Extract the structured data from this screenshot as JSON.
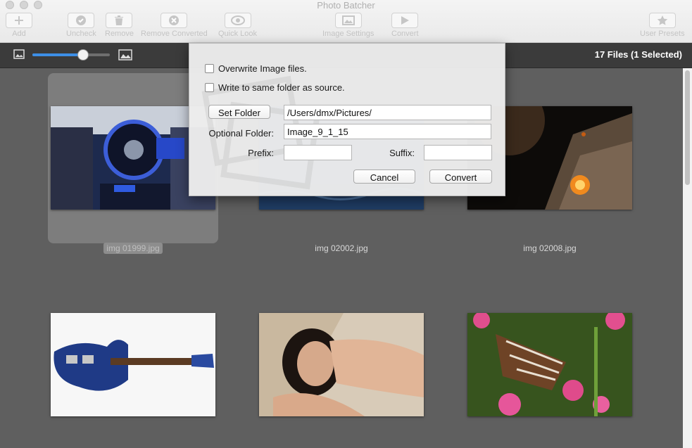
{
  "window": {
    "title": "Photo Batcher"
  },
  "toolbar": {
    "add": "Add",
    "uncheck": "Uncheck",
    "remove": "Remove",
    "remove_converted": "Remove Converted",
    "quick_look": "Quick Look",
    "image_settings": "Image Settings",
    "convert": "Convert",
    "user_presets": "User Presets"
  },
  "status": {
    "file_count": "17 Files (1 Selected)"
  },
  "zoom": {
    "level": 0.65
  },
  "files": [
    {
      "name": "img 01999.jpg",
      "selected": true
    },
    {
      "name": "img 02002.jpg",
      "selected": false
    },
    {
      "name": "img 02008.jpg",
      "selected": false
    },
    {
      "name": "",
      "selected": false
    },
    {
      "name": "",
      "selected": false
    },
    {
      "name": "",
      "selected": false
    }
  ],
  "dialog": {
    "overwrite_label": "Overwrite Image files.",
    "overwrite_checked": false,
    "same_folder_label": "Write to same folder as source.",
    "same_folder_checked": false,
    "set_folder_button": "Set Folder",
    "folder_path": "/Users/dmx/Pictures/",
    "optional_folder_label": "Optional Folder:",
    "optional_folder_value": "Image_9_1_15",
    "prefix_label": "Prefix:",
    "prefix_value": "",
    "suffix_label": "Suffix:",
    "suffix_value": "",
    "cancel_button": "Cancel",
    "convert_button": "Convert"
  },
  "colors": {
    "accent": "#3d8fe6",
    "grid_bg": "#5f5f5f",
    "toolbar_bg": "#3b3b3b"
  }
}
